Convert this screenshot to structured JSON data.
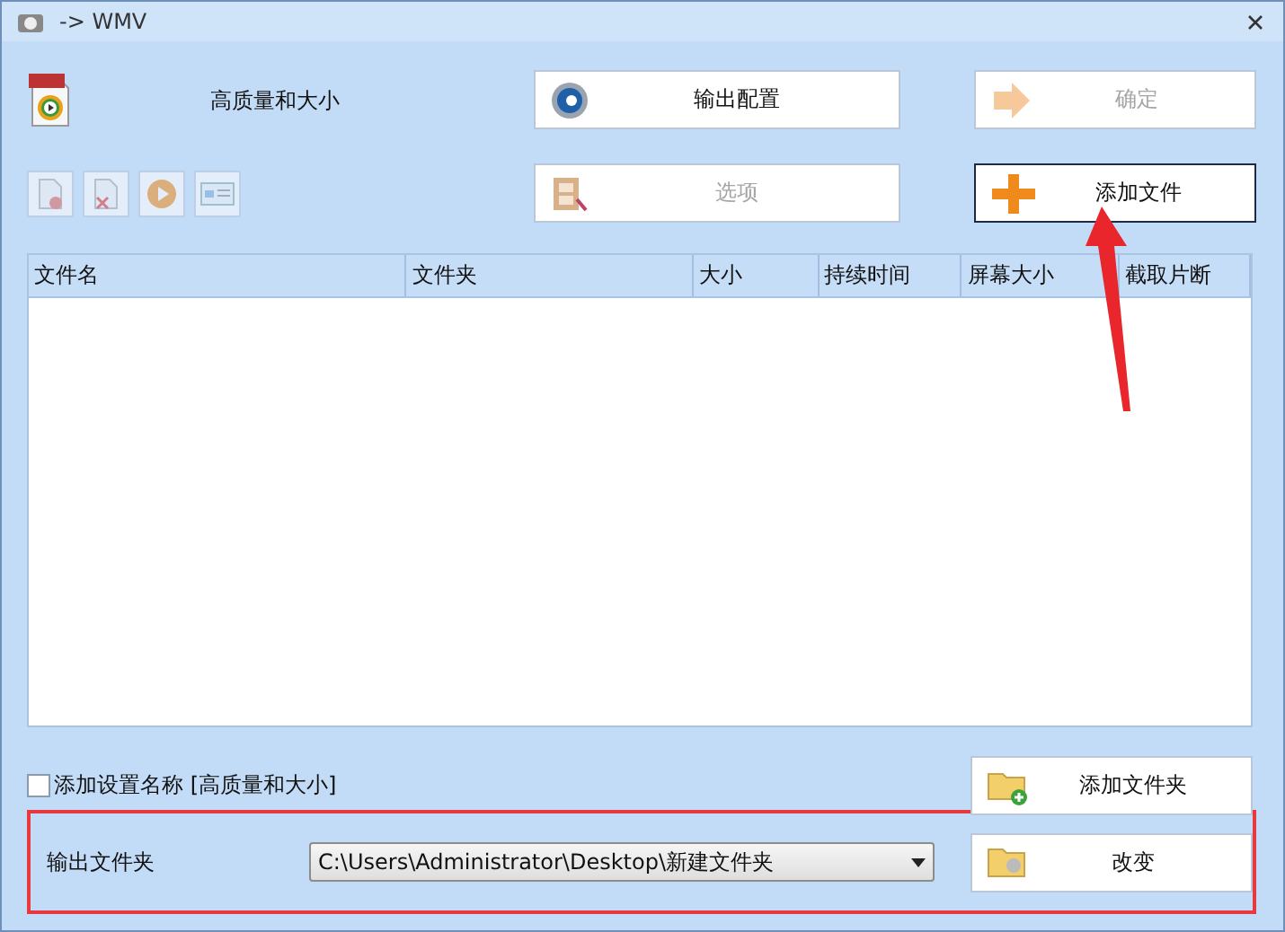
{
  "window": {
    "title": "-> WMV"
  },
  "preset": {
    "name": "高质量和大小"
  },
  "top_buttons": [
    {
      "kind": "config",
      "label": "输出配置",
      "disabled": false,
      "focused": false
    },
    {
      "kind": "ok",
      "label": "确定",
      "disabled": true,
      "focused": false
    },
    {
      "kind": "options",
      "label": "选项",
      "disabled": true,
      "focused": false
    },
    {
      "kind": "add",
      "label": "添加文件",
      "disabled": false,
      "focused": true
    }
  ],
  "tools": [
    {
      "kind": "remove",
      "disabled": true
    },
    {
      "kind": "clear",
      "disabled": true
    },
    {
      "kind": "play",
      "disabled": true
    },
    {
      "kind": "info",
      "disabled": true
    }
  ],
  "table": {
    "columns": [
      "文件名",
      "文件夹",
      "大小",
      "持续时间",
      "屏幕大小",
      "截取片断"
    ]
  },
  "option": {
    "label": "添加设置名称 [高质量和大小]",
    "checked": false
  },
  "add_folder_button": {
    "label": "添加文件夹"
  },
  "output": {
    "label": "输出文件夹",
    "path": "C:\\Users\\Administrator\\Desktop\\新建文件夹",
    "button": "改变"
  }
}
